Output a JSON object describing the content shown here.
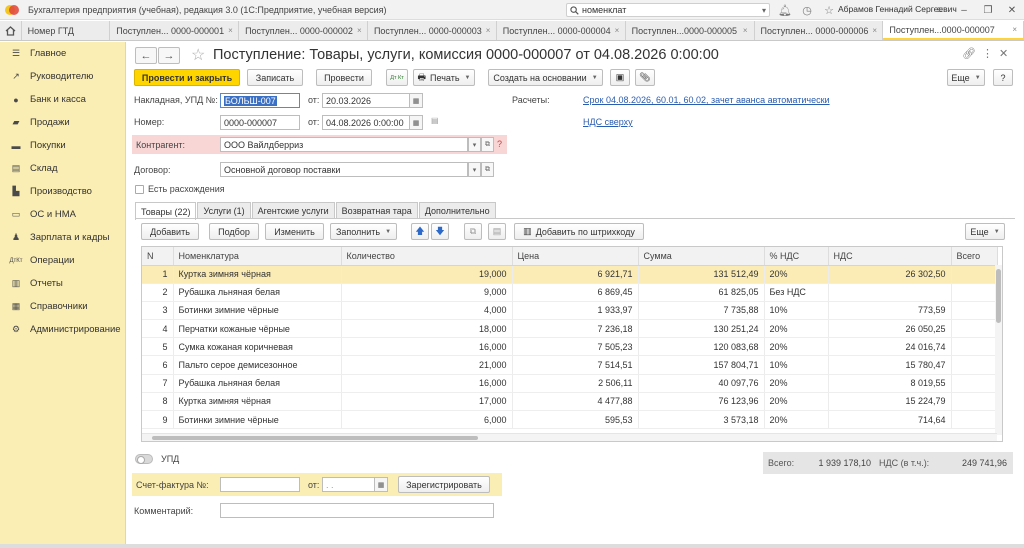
{
  "window": {
    "title": "Бухгалтерия предприятия (учебная), редакция 3.0  (1С:Предприятие, учебная версия)",
    "search_value": "номенклат",
    "user": "Абрамов Геннадий Сергеевич"
  },
  "tabs": [
    {
      "label": "Номер ГТД",
      "close": "×"
    },
    {
      "label": "Поступлен... 0000-000001",
      "close": "×"
    },
    {
      "label": "Поступлен... 0000-000002",
      "close": "×"
    },
    {
      "label": "Поступлен... 0000-000003",
      "close": "×"
    },
    {
      "label": "Поступлен... 0000-000004",
      "close": "×"
    },
    {
      "label": "Поступлен...0000-000005",
      "close": "×"
    },
    {
      "label": "Поступлен... 0000-000006",
      "close": "×"
    },
    {
      "label": "Поступлен...0000-000007",
      "close": "×"
    }
  ],
  "sidebar": {
    "items": [
      {
        "label": "Главное",
        "icon": "menu-icon"
      },
      {
        "label": "Руководителю",
        "icon": "chart-icon"
      },
      {
        "label": "Банк и касса",
        "icon": "coins-icon"
      },
      {
        "label": "Продажи",
        "icon": "bag-icon"
      },
      {
        "label": "Покупки",
        "icon": "basket-icon"
      },
      {
        "label": "Склад",
        "icon": "warehouse-icon"
      },
      {
        "label": "Производство",
        "icon": "factory-icon"
      },
      {
        "label": "ОС и НМА",
        "icon": "truck-icon"
      },
      {
        "label": "Зарплата и кадры",
        "icon": "people-icon"
      },
      {
        "label": "Операции",
        "icon": "dt-kt-icon"
      },
      {
        "label": "Отчеты",
        "icon": "report-icon"
      },
      {
        "label": "Справочники",
        "icon": "book-icon"
      },
      {
        "label": "Администрирование",
        "icon": "gear-icon"
      }
    ]
  },
  "document": {
    "title": "Поступление: Товары, услуги, комиссия 0000-000007 от 04.08.2026 0:00:00",
    "buttons": {
      "post_close": "Провести и закрыть",
      "save": "Записать",
      "post": "Провести",
      "dtkt": "Дт Кт",
      "print": "Печать",
      "create_based": "Создать на основании",
      "more": "Еще",
      "help": "?"
    },
    "fields": {
      "invoice_label": "Накладная, УПД №:",
      "invoice_value": "БОЛЬШ-007",
      "invoice_from_label": "от:",
      "invoice_date": "20.03.2026",
      "number_label": "Номер:",
      "number_value": "0000-000007",
      "number_from_label": "от:",
      "number_date": "04.08.2026  0:00:00",
      "settlements_label": "Расчеты:",
      "settlements_link": "Срок 04.08.2026, 60.01, 60.02, зачет аванса автоматически",
      "vat_link": "НДС сверху",
      "counterparty_label": "Контрагент:",
      "counterparty_value": "ООО Вайлдберриз",
      "contract_label": "Договор:",
      "contract_value": "Основной договор поставки",
      "discrepancy_label": "Есть расхождения"
    },
    "form_tabs": [
      "Товары (22)",
      "Услуги (1)",
      "Агентские услуги",
      "Возвратная тара",
      "Дополнительно"
    ],
    "table_toolbar": {
      "add": "Добавить",
      "pick": "Подбор",
      "edit": "Изменить",
      "fill": "Заполнить",
      "barcode": "Добавить по штрихкоду",
      "more": "Еще"
    },
    "table": {
      "columns": [
        "N",
        "Номенклатура",
        "Количество",
        "Цена",
        "Сумма",
        "% НДС",
        "НДС",
        "Всего"
      ],
      "rows": [
        [
          "1",
          "Куртка зимняя чёрная",
          "19,000",
          "6 921,71",
          "131 512,49",
          "20%",
          "26 302,50",
          ""
        ],
        [
          "2",
          "Рубашка льняная белая",
          "9,000",
          "6 869,45",
          "61 825,05",
          "Без НДС",
          "",
          ""
        ],
        [
          "3",
          "Ботинки зимние чёрные",
          "4,000",
          "1 933,97",
          "7 735,88",
          "10%",
          "773,59",
          ""
        ],
        [
          "4",
          "Перчатки кожаные чёрные",
          "18,000",
          "7 236,18",
          "130 251,24",
          "20%",
          "26 050,25",
          ""
        ],
        [
          "5",
          "Сумка кожаная коричневая",
          "16,000",
          "7 505,23",
          "120 083,68",
          "20%",
          "24 016,74",
          ""
        ],
        [
          "6",
          "Пальто серое демисезонное",
          "21,000",
          "7 514,51",
          "157 804,71",
          "10%",
          "15 780,47",
          ""
        ],
        [
          "7",
          "Рубашка льняная белая",
          "16,000",
          "2 506,11",
          "40 097,76",
          "20%",
          "8 019,55",
          ""
        ],
        [
          "8",
          "Куртка зимняя чёрная",
          "17,000",
          "4 477,88",
          "76 123,96",
          "20%",
          "15 224,79",
          ""
        ],
        [
          "9",
          "Ботинки зимние чёрные",
          "6,000",
          "595,53",
          "3 573,18",
          "20%",
          "714,64",
          ""
        ]
      ],
      "selected_row": 0
    },
    "upd_label": "УПД",
    "totals": {
      "total_label": "Всего:",
      "total_value": "1 939 178,10",
      "vat_label": "НДС (в т.ч.):",
      "vat_value": "249 741,96"
    },
    "invoice_section": {
      "label": "Счет-фактура №:",
      "from_label": "от:",
      "date_placeholder": " .  .",
      "register": "Зарегистрировать"
    },
    "comment_label": "Комментарий:"
  }
}
